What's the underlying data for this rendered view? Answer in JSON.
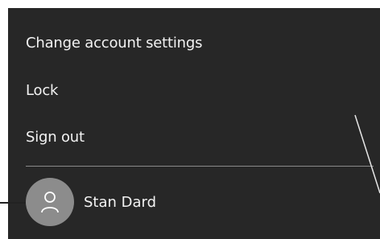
{
  "menu": {
    "items": [
      {
        "label": "Change account settings"
      },
      {
        "label": "Lock"
      },
      {
        "label": "Sign out"
      }
    ]
  },
  "user": {
    "name": "Stan Dard",
    "avatar_icon": "user-avatar-icon"
  },
  "colors": {
    "menu_background": "#272727",
    "text": "#f2f2f2",
    "avatar_background": "#8c8c8c",
    "divider": "#8a8a8a",
    "callout_line": "#333333"
  }
}
